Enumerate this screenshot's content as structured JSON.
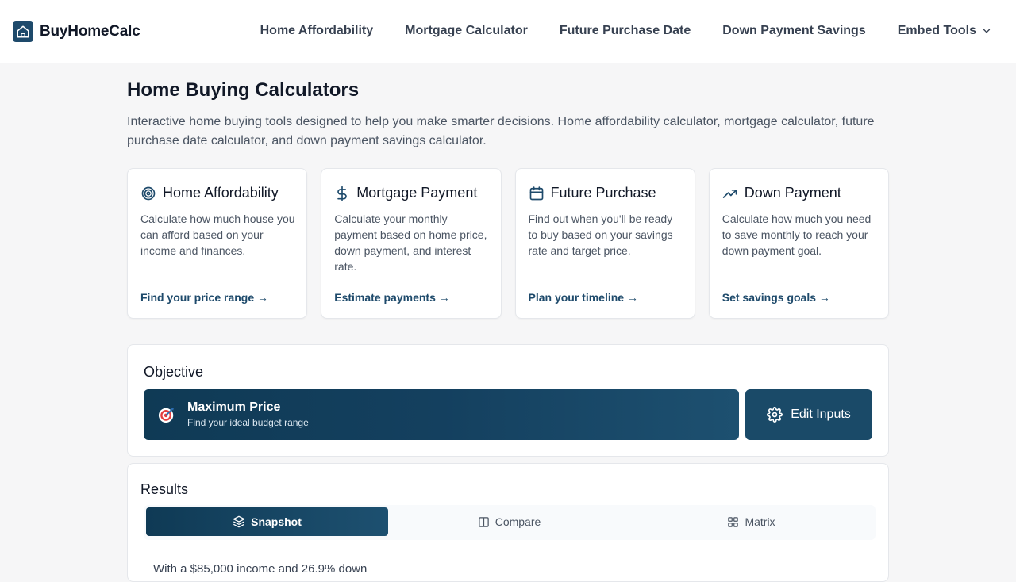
{
  "brand": {
    "name": "BuyHomeCalc",
    "logo_icon": "house-icon",
    "color": "#1e4a6b"
  },
  "nav": {
    "items": [
      {
        "label": "Home Affordability"
      },
      {
        "label": "Mortgage Calculator"
      },
      {
        "label": "Future Purchase Date"
      },
      {
        "label": "Down Payment Savings"
      },
      {
        "label": "Embed Tools",
        "icon": "chevron-down-icon"
      }
    ]
  },
  "page": {
    "title": "Home Buying Calculators",
    "description": "Interactive home buying tools designed to help you make smarter decisions. Home affordability calculator, mortgage calculator, future purchase date calculator, and down payment savings calculator."
  },
  "cards": [
    {
      "icon": "target-icon",
      "title": "Home Affordability",
      "description": "Calculate how much house you can afford based on your income and finances.",
      "link": "Find your price range →"
    },
    {
      "icon": "dollar-icon",
      "title": "Mortgage Payment",
      "description": "Calculate your monthly payment based on home price, down payment, and interest rate.",
      "link": "Estimate payments →"
    },
    {
      "icon": "calendar-icon",
      "title": "Future Purchase",
      "description": "Find out when you'll be ready to buy based on your savings rate and target price.",
      "link": "Plan your timeline →"
    },
    {
      "icon": "trending-up-icon",
      "title": "Down Payment",
      "description": "Calculate how much you need to save monthly to reach your down payment goal.",
      "link": "Set savings goals →"
    }
  ],
  "objective": {
    "title": "Objective",
    "selected_title": "Maximum Price",
    "selected_subtitle": "Find your ideal budget range",
    "edit_label": "Edit Inputs"
  },
  "results": {
    "title": "Results",
    "tabs": [
      {
        "label": "Snapshot",
        "icon": "layers-icon",
        "active": true
      },
      {
        "label": "Compare",
        "icon": "columns-icon",
        "active": false
      },
      {
        "label": "Matrix",
        "icon": "grid-icon",
        "active": false
      }
    ],
    "summary": "With a $85,000 income and 26.9% down"
  },
  "colors": {
    "accent": "#1e4a6b",
    "banner_start": "#0f3a55",
    "banner_end": "#1d5070"
  }
}
